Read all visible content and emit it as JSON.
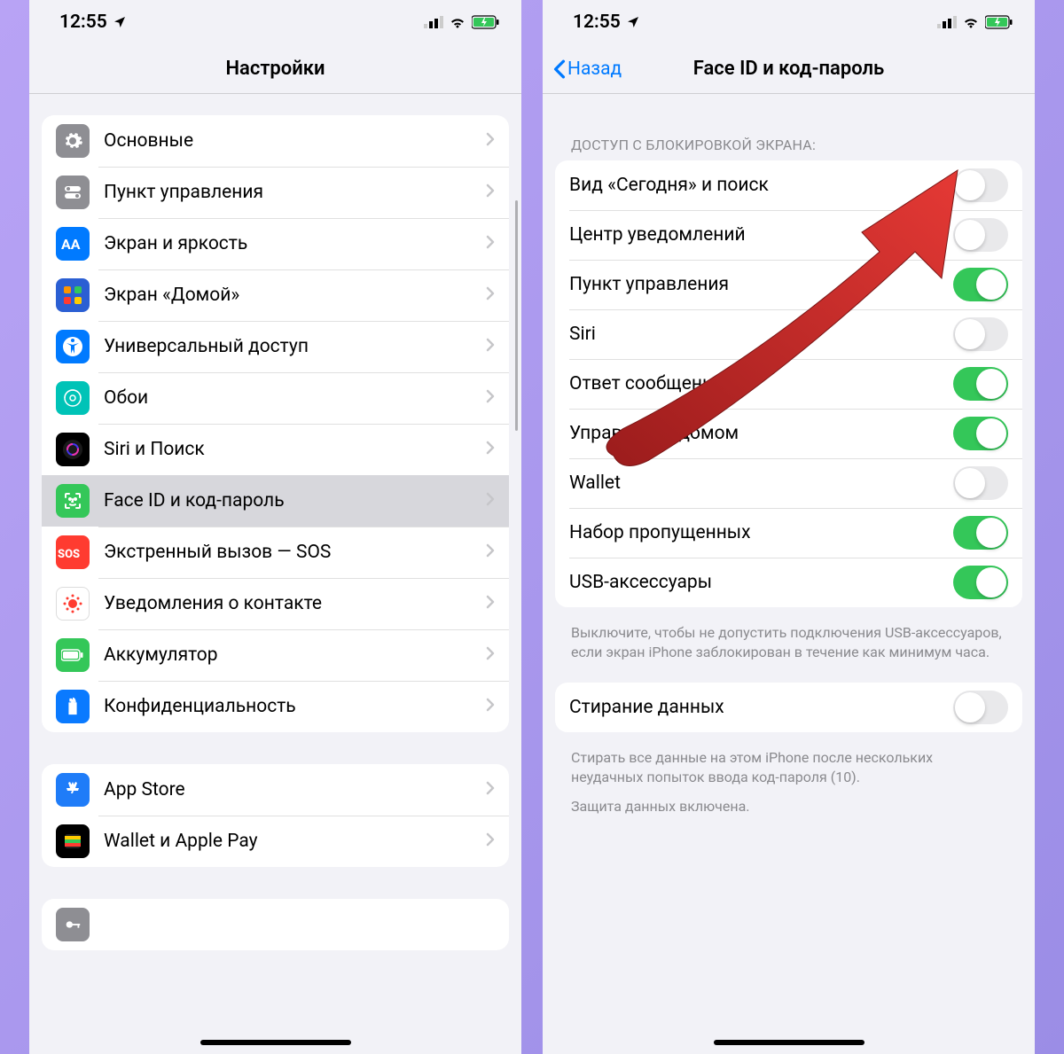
{
  "status": {
    "time": "12:55"
  },
  "left": {
    "title": "Настройки",
    "group1": [
      {
        "icon": "gear-icon",
        "bg": "bg-gray",
        "label": "Основные"
      },
      {
        "icon": "control-icon",
        "bg": "bg-gray",
        "label": "Пункт управления"
      },
      {
        "icon": "display-icon",
        "bg": "bg-blue",
        "label": "Экран и яркость"
      },
      {
        "icon": "home-grid-icon",
        "bg": "bg-darkblue",
        "label": "Экран «Домой»"
      },
      {
        "icon": "accessibility-icon",
        "bg": "bg-blue",
        "label": "Универсальный доступ"
      },
      {
        "icon": "wallpaper-icon",
        "bg": "bg-teal",
        "label": "Обои"
      },
      {
        "icon": "siri-icon",
        "bg": "bg-black",
        "label": "Siri и Поиск"
      },
      {
        "icon": "faceid-icon",
        "bg": "bg-green",
        "label": "Face ID и код-пароль",
        "selected": true
      },
      {
        "icon": "sos-icon",
        "bg": "bg-red",
        "label": "Экстренный вызов — SOS"
      },
      {
        "icon": "exposure-icon",
        "bg": "bg-white",
        "label": "Уведомления о контакте"
      },
      {
        "icon": "battery-icon",
        "bg": "bg-green",
        "label": "Аккумулятор"
      },
      {
        "icon": "privacy-icon",
        "bg": "bg-hand",
        "label": "Конфиденциальность"
      }
    ],
    "group2": [
      {
        "icon": "appstore-icon",
        "bg": "bg-appstore",
        "label": "App Store"
      },
      {
        "icon": "wallet-icon",
        "bg": "bg-black",
        "label": "Wallet и Apple Pay"
      }
    ]
  },
  "right": {
    "back": "Назад",
    "title": "Face ID и код-пароль",
    "sectionHeader": "ДОСТУП С БЛОКИРОВКОЙ ЭКРАНА:",
    "toggles": [
      {
        "label": "Вид «Сегодня» и поиск",
        "on": false
      },
      {
        "label": "Центр уведомлений",
        "on": false
      },
      {
        "label": "Пункт управления",
        "on": true
      },
      {
        "label": "Siri",
        "on": false
      },
      {
        "label": "Ответ сообщением",
        "on": true
      },
      {
        "label": "Управление домом",
        "on": true
      },
      {
        "label": "Wallet",
        "on": false
      },
      {
        "label": "Набор пропущенных",
        "on": true
      },
      {
        "label": "USB-аксессуары",
        "on": true
      }
    ],
    "usbNote": "Выключите, чтобы не допустить подключения USB-аксессуаров, если экран iPhone заблокирован в течение как минимум часа.",
    "erase": {
      "label": "Стирание данных",
      "on": false
    },
    "eraseNote": "Стирать все данные на этом iPhone после нескольких неудачных попыток ввода код-пароля (10).",
    "protectionNote": "Защита данных включена."
  }
}
